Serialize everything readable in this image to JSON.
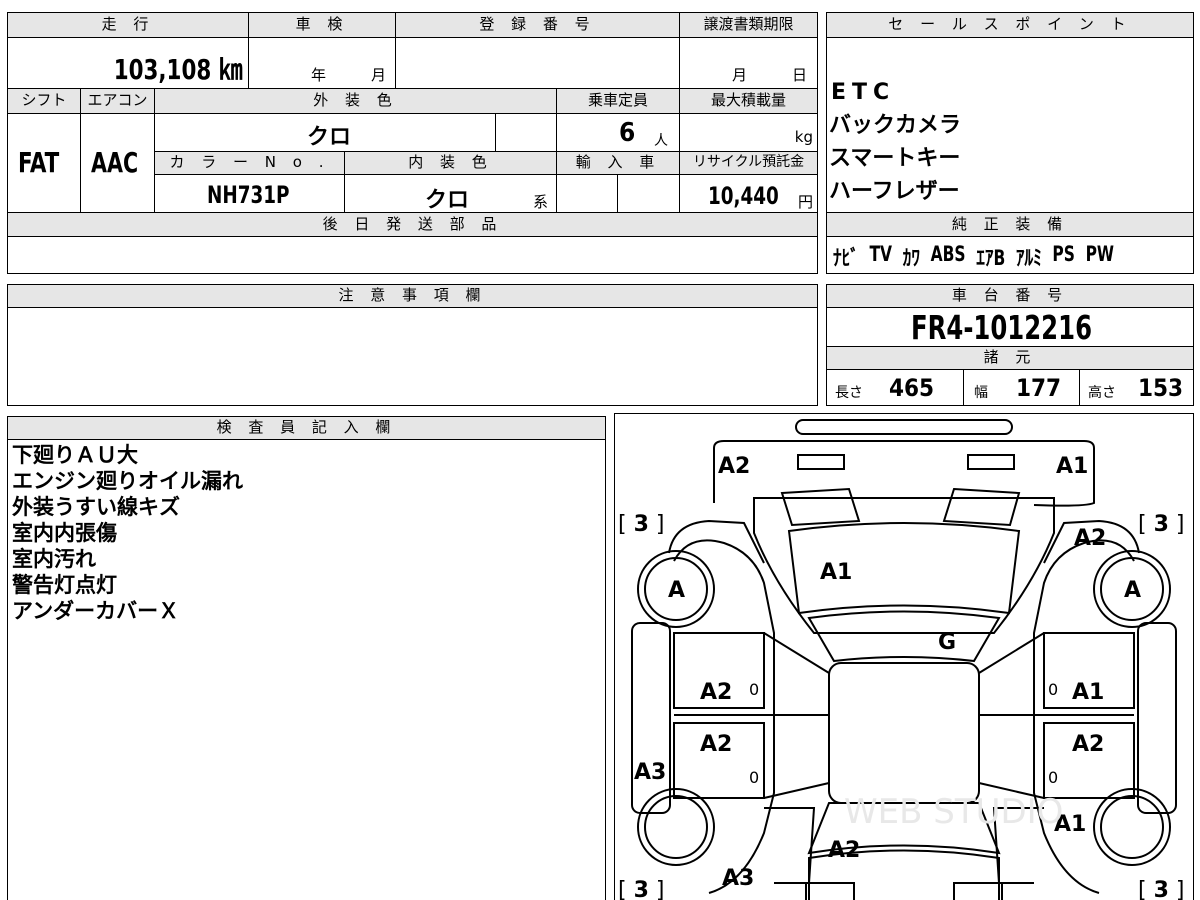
{
  "top_table": {
    "headers": {
      "mileage": "走 行",
      "shaken": "車 検",
      "registration_no": "登 録 番 号",
      "transfer_deadline": "譲渡書類期限",
      "sales_points": "セ ー ル ス ポ イ ン ト",
      "shift": "シフト",
      "aircon": "エアコン",
      "exterior_color": "外 装 色",
      "capacity": "乗車定員",
      "max_load": "最大積載量",
      "color_no": "カ ラ ー N o .",
      "interior_color": "内 装 色",
      "import": "輸 入 車",
      "recycle_fee": "リサイクル預託金",
      "later_parts": "後 日 発 送 部 品",
      "genuine_equipment": "純 正 装 備"
    },
    "mileage_value": "103,108 ㎞",
    "shaken_year_unit": "年",
    "shaken_month_unit": "月",
    "transfer_month_unit": "月",
    "transfer_day_unit": "日",
    "shift_value": "FAT",
    "aircon_value": "AAC",
    "exterior_color_value": "クロ",
    "capacity_value": "6",
    "capacity_unit": "人",
    "max_load_unit": "kg",
    "color_no_value": "NH731P",
    "interior_color_value": "クロ",
    "interior_color_suffix": "系",
    "recycle_fee_value": "10,440",
    "recycle_fee_unit": "円"
  },
  "sales_points": [
    "ETC",
    "バックカメラ",
    "スマートキー",
    "ハーフレザー"
  ],
  "genuine_equipment": [
    "ﾅﾋﾞ",
    "TV",
    "ｶﾜ",
    "ABS",
    "ｴｱB",
    "ｱﾙﾐ",
    "PS",
    "PW"
  ],
  "notes": {
    "header": "注 意 事 項 欄"
  },
  "chassis": {
    "header": "車 台 番 号",
    "number": "FR4-1012216"
  },
  "specs": {
    "header": "諸 元",
    "length_label": "長さ",
    "length_value": "465",
    "width_label": "幅",
    "width_value": "177",
    "height_label": "高さ",
    "height_value": "153"
  },
  "inspector": {
    "header": "検 査 員 記 入 欄",
    "lines": [
      "下廻りＡＵ大",
      "エンジン廻りオイル漏れ",
      "外装うすい線キズ",
      "室内内張傷",
      "室内汚れ",
      "警告灯点灯",
      "アンダーカバーＸ"
    ]
  },
  "diagram": {
    "marks": {
      "front_bumper_left": "A2",
      "front_bumper_right": "A1",
      "hood": "A1",
      "windshield": "G",
      "left_front_fender": "A2",
      "right_front_fender": "A2",
      "left_front_door": "A2",
      "right_front_door": "A1",
      "left_rear_door": "A2",
      "right_rear_door": "A2",
      "left_side_sill": "A3",
      "right_rear_quarter": "A1",
      "roof_rear": "A2",
      "rear_bumper": "A3",
      "left_front_wheel": "A",
      "right_front_wheel": "A",
      "bracket_value": "3",
      "small_zero": "0"
    },
    "watermark": "WEB STUDIO"
  }
}
